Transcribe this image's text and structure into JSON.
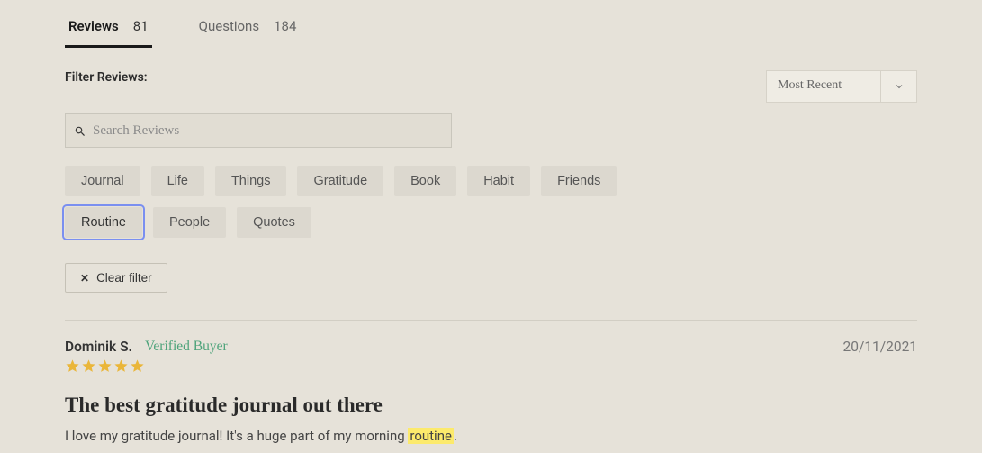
{
  "tabs": [
    {
      "label": "Reviews",
      "count": "81",
      "active": true
    },
    {
      "label": "Questions",
      "count": "184",
      "active": false
    }
  ],
  "filter": {
    "label": "Filter Reviews:",
    "searchPlaceholder": "Search Reviews",
    "chips": [
      "Journal",
      "Life",
      "Things",
      "Gratitude",
      "Book",
      "Habit",
      "Friends",
      "Routine",
      "People",
      "Quotes"
    ],
    "selected": "Routine",
    "clearLabel": "Clear filter"
  },
  "sort": {
    "selected": "Most Recent"
  },
  "review": {
    "name": "Dominik S.",
    "verified": "Verified Buyer",
    "date": "20/11/2021",
    "rating": 5,
    "title": "The best gratitude journal out there",
    "bodyPre": "I love my gratitude journal! It's a huge part of my morning ",
    "highlight": "routine",
    "bodyPost": "."
  }
}
